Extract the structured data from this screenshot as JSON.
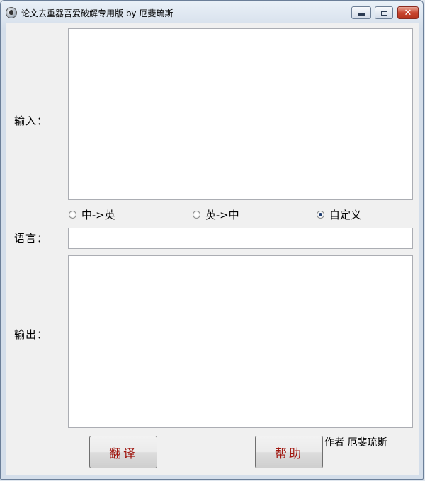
{
  "window": {
    "title": "论文去重器吾爱破解专用版 by 厄斐琉斯",
    "min_icon": "minimize-icon",
    "max_icon": "maximize-icon",
    "close_icon": "close-icon",
    "close_symbol": "✕"
  },
  "input_section": {
    "label": "输入：",
    "value": ""
  },
  "language": {
    "options": [
      {
        "label": "中->英",
        "checked": false
      },
      {
        "label": "英->中",
        "checked": false
      },
      {
        "label": "自定义",
        "checked": true
      }
    ],
    "label": "语言：",
    "value": ""
  },
  "output_section": {
    "label": "输出：",
    "value": ""
  },
  "buttons": {
    "translate": "翻译",
    "help": "帮助"
  },
  "footer": {
    "author": "作者 厄斐琉斯"
  },
  "colors": {
    "button_text": "#a0160f",
    "close_button": "#c9462f"
  }
}
